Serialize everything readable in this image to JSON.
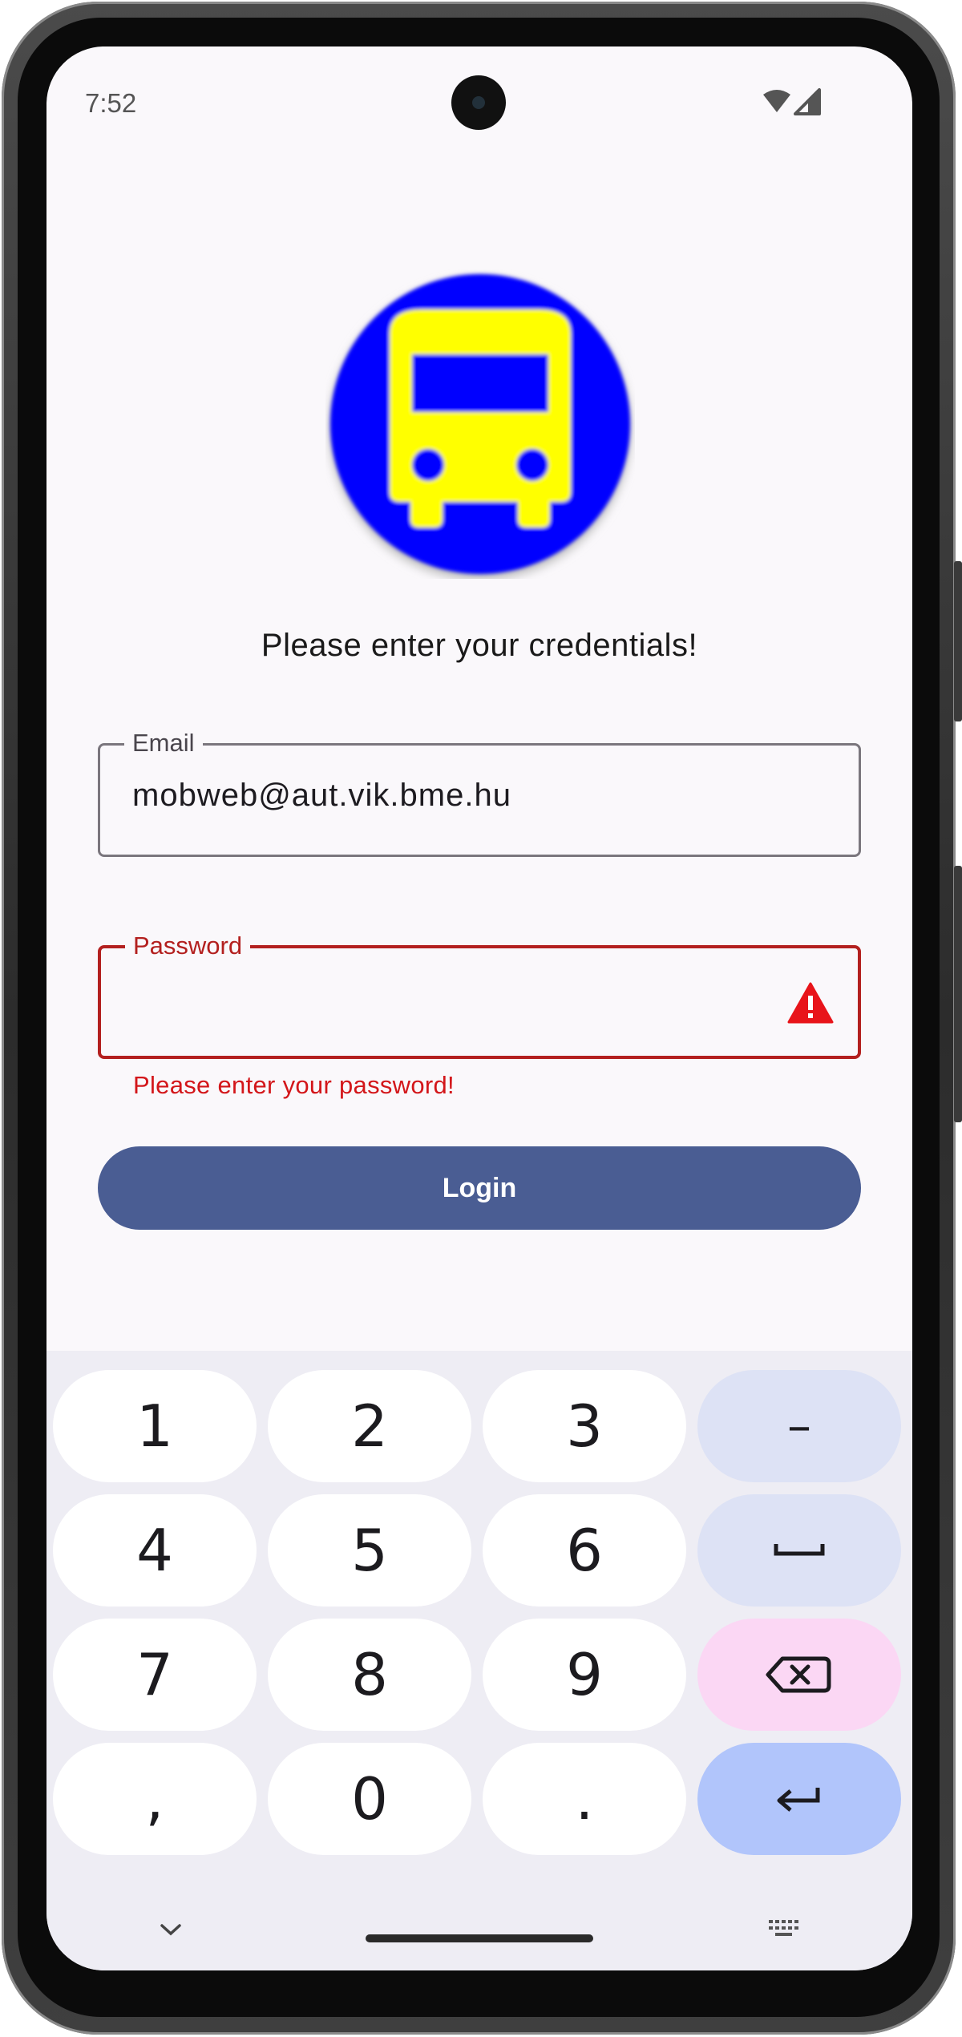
{
  "status_bar": {
    "time": "7:52",
    "icons": [
      "wifi-icon",
      "cellular-signal-icon"
    ]
  },
  "logo": {
    "icon": "bus-icon",
    "colors": {
      "circle": "#0000ff",
      "bus": "#ffff00"
    }
  },
  "prompt": "Please enter your credentials!",
  "email_field": {
    "label": "Email",
    "value": "mobweb@aut.vik.bme.hu"
  },
  "password_field": {
    "label": "Password",
    "value": "",
    "error_icon": "warning-icon",
    "error_text": "Please enter your password!"
  },
  "login_button": {
    "label": "Login"
  },
  "keyboard": {
    "rows": [
      [
        "1",
        "2",
        "3",
        "–"
      ],
      [
        "4",
        "5",
        "6",
        "space-icon"
      ],
      [
        "7",
        "8",
        "9",
        "backspace-icon"
      ],
      [
        ",",
        "0",
        ".",
        "enter-icon"
      ]
    ],
    "bottom": [
      "hide-keyboard-icon",
      "keyboard-switch-icon"
    ]
  },
  "colors": {
    "accent": "#4a5d93",
    "error": "#b3201f",
    "key_function": "#dde2f5",
    "key_delete": "#fbd7f4",
    "key_enter": "#b1c5fb"
  }
}
